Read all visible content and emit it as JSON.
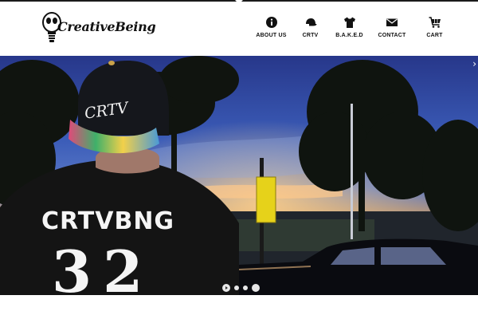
{
  "brand": {
    "name": "CreativeBeing"
  },
  "nav": {
    "items": [
      {
        "label": "ABOUT US",
        "icon": "info-icon"
      },
      {
        "label": "CRTV",
        "icon": "cap-icon"
      },
      {
        "label": "B.A.K.E.D",
        "icon": "tshirt-icon"
      },
      {
        "label": "CONTACT",
        "icon": "envelope-icon"
      },
      {
        "label": "CART",
        "icon": "cart-icon"
      }
    ]
  },
  "hero": {
    "hat_text": "CRTV",
    "shirt_text": "CRTVBNG",
    "shirt_number": "32",
    "next_symbol": "›",
    "slides_count": 4,
    "active_slide": 4
  },
  "colors": {
    "text": "#111111",
    "sky_top": "#2a3d8a",
    "sky_glow": "#e8a24a"
  }
}
